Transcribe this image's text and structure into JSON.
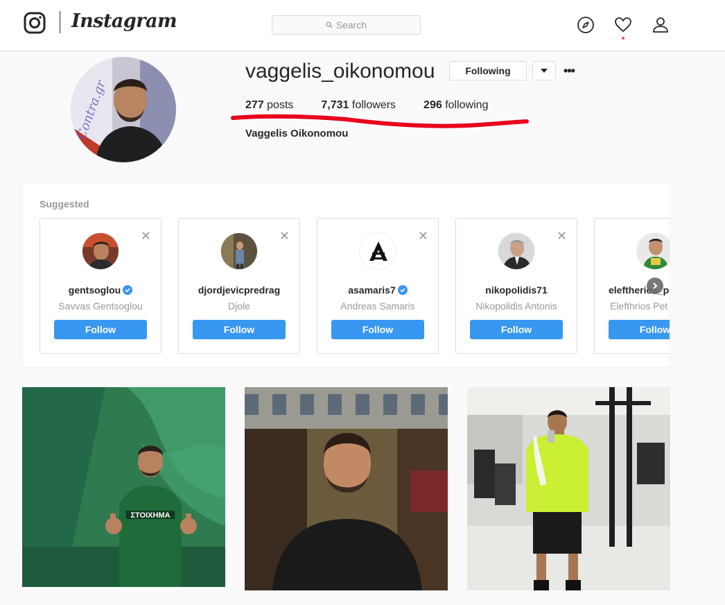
{
  "header": {
    "brand": "Instagram",
    "search_placeholder": "Search"
  },
  "profile": {
    "username": "vaggelis_oikonomou",
    "following_button": "Following",
    "stats": [
      {
        "value": "277",
        "label": "posts"
      },
      {
        "value": "7,731",
        "label": "followers"
      },
      {
        "value": "296",
        "label": "following"
      }
    ],
    "full_name": "Vaggelis Oikonomou",
    "avatar_watermark": "Contra.gr"
  },
  "suggested": {
    "title": "Suggested",
    "cards": [
      {
        "username": "gentsoglou",
        "full_name": "Savvas Gentsoglou",
        "verified": true,
        "button": "Follow"
      },
      {
        "username": "djordjevicpredrag",
        "full_name": "Djole",
        "verified": false,
        "button": "Follow"
      },
      {
        "username": "asamaris7",
        "full_name": "Andreas Samaris",
        "verified": true,
        "button": "Follow"
      },
      {
        "username": "nikopolidis71",
        "full_name": "Nikopolidis Antonis",
        "verified": false,
        "button": "Follow"
      },
      {
        "username": "eleftherios_pe",
        "full_name": "Elefthrios Pet",
        "verified": false,
        "button": "Follow"
      }
    ]
  },
  "posts": [
    {
      "jersey_text": "ΣΤΟΙΧΗΜΑ"
    },
    {
      "jersey_text": ""
    },
    {
      "jersey_text": ""
    }
  ],
  "colors": {
    "accent": "#3897f0",
    "annotation": "#e8001c"
  }
}
